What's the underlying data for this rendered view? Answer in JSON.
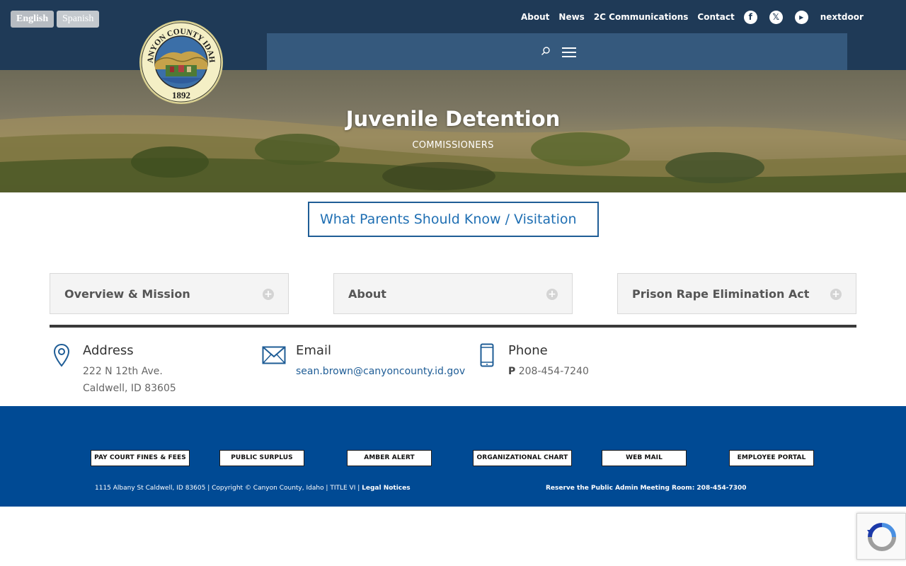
{
  "languages": {
    "english": "English",
    "spanish": "Spanish"
  },
  "topnav": {
    "about": "About",
    "news": "News",
    "communications": "2C Communications",
    "contact": "Contact",
    "nextdoor": "nextdoor"
  },
  "social": [
    {
      "name": "facebook-icon",
      "glyph": "f"
    },
    {
      "name": "x-icon",
      "glyph": "𝕏"
    },
    {
      "name": "youtube-icon",
      "glyph": "▶"
    }
  ],
  "seal": {
    "text": "CANYON COUNTY IDAHO",
    "year": "1892"
  },
  "hero": {
    "title": "Juvenile Detention",
    "subtitle": "COMMISSIONERS"
  },
  "visitation_button": "What Parents Should Know / Visitation",
  "toggles": [
    {
      "label": "Overview & Mission"
    },
    {
      "label": "About"
    },
    {
      "label": "Prison Rape Elimination Act"
    }
  ],
  "contact": {
    "address": {
      "title": "Address",
      "line1": "222 N 12th Ave.",
      "line2": "Caldwell, ID 83605"
    },
    "email": {
      "title": "Email",
      "value": "sean.brown@canyoncounty.id.gov"
    },
    "phone": {
      "title": "Phone",
      "prefix": "P",
      "value": "208-454-7240"
    }
  },
  "footer": {
    "buttons": [
      "PAY COURT FINES & FEES",
      "PUBLIC SURPLUS",
      "AMBER ALERT",
      "ORGANIZATIONAL CHART",
      "WEB MAIL",
      "EMPLOYEE PORTAL"
    ],
    "address_line": "1115 Albany St Caldwell, ID 83605 | Copyright © Canyon County, Idaho | TITLE VI |",
    "legal": "Legal Notices",
    "reserve": "Reserve the Public Admin Meeting Room: 208-454-7300"
  },
  "colors": {
    "header": "#1f3a57",
    "nav_panel": "#35597d",
    "footer": "#004a94",
    "link": "#1f5d96"
  }
}
